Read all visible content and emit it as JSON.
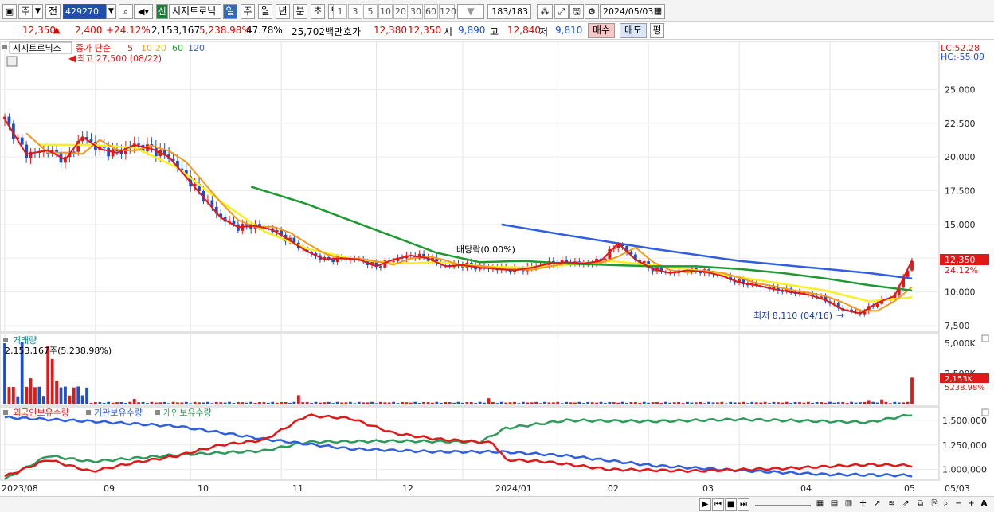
{
  "toolbar": {
    "market": "주",
    "prev_label": "전",
    "code": "429270",
    "sin_label": "신",
    "stock_name": "시지트로닉",
    "period_tabs": [
      "일",
      "주",
      "월",
      "년",
      "분",
      "초",
      "틱"
    ],
    "active_tab": "일",
    "minute_options": [
      "1",
      "3",
      "5",
      "10",
      "20",
      "30",
      "60",
      "120"
    ],
    "count": "183",
    "count_total": "/183",
    "date": "2024/05/03"
  },
  "quote": {
    "price": "12,350",
    "change_arrow": "▲",
    "change": "2,400",
    "change_pct": "+24.12%",
    "volume": "2,153,167",
    "volume_pct": "5,238.98%",
    "turnover_pct": "47.78%",
    "amount": "25,702백만",
    "bid_label": "호가",
    "ask_price": "12,380",
    "bid_price": "12,350",
    "open_label": "시",
    "open": "9,890",
    "high_label": "고",
    "high": "12,840",
    "low_label": "저",
    "low": "9,810",
    "buy_label": "매수",
    "sell_label": "매도",
    "avg_label": "평"
  },
  "price_panel": {
    "stock_label": "시지트로닉스",
    "ma_title": "종가 단순",
    "ma_periods": [
      "5",
      "10",
      "20",
      "60",
      "120"
    ],
    "high_note": "최고 27,500 (08/22)",
    "low_note": "최저 8,110 (04/16)",
    "dividend_note": "배당락(0.00%)",
    "lc": "LC:52.28",
    "hc": "HC:-55.09",
    "price_tag": "12,350",
    "pct_tag": "24.12%",
    "y_ticks": [
      "25,000",
      "22,500",
      "20,000",
      "17,500",
      "15,000",
      "12,500",
      "10,000",
      "7,500"
    ]
  },
  "volume_panel": {
    "title": "거래량",
    "value_label": "2,153,167주(5,238.98%)",
    "y_ticks": [
      "5,000K",
      "2,500K"
    ],
    "tag": "2,153K",
    "tag_pct": "5238.98%"
  },
  "holder_panel": {
    "series_labels": [
      "외국인보유수량",
      "기관보유수량",
      "개인보유수량"
    ],
    "y_ticks": [
      "1,500,000",
      "1,250,000",
      "1,000,000"
    ]
  },
  "x_axis": [
    "2023/08",
    "09",
    "10",
    "11",
    "12",
    "2024/01",
    "02",
    "03",
    "04",
    "05",
    "05/03"
  ],
  "colors": {
    "ma5": "#e01818",
    "ma10": "#f39a1e",
    "ma20": "#f8f020",
    "ma60": "#1e9a32",
    "ma120": "#2f5fe0",
    "up": "#e01818",
    "down": "#1d4fc8",
    "foreign": "#e01818",
    "institution": "#2f5fe0",
    "individual": "#2e9a5a"
  },
  "chart_data": {
    "type": "candlestick",
    "dates_range": [
      "2023/08",
      "2024/05/03"
    ],
    "candles_count": 183,
    "price_ylim": [
      7500,
      27500
    ],
    "close_path": [
      [
        0,
        22800
      ],
      [
        5,
        20200
      ],
      [
        10,
        20500
      ],
      [
        14,
        19800
      ],
      [
        18,
        21500
      ],
      [
        22,
        20600
      ],
      [
        26,
        20300
      ],
      [
        30,
        20900
      ],
      [
        34,
        20600
      ],
      [
        38,
        20000
      ],
      [
        42,
        18500
      ],
      [
        46,
        17000
      ],
      [
        50,
        15500
      ],
      [
        54,
        14800
      ],
      [
        58,
        14900
      ],
      [
        62,
        14600
      ],
      [
        66,
        13800
      ],
      [
        70,
        13000
      ],
      [
        74,
        12400
      ],
      [
        78,
        12500
      ],
      [
        82,
        12400
      ],
      [
        86,
        11900
      ],
      [
        90,
        12400
      ],
      [
        94,
        12700
      ],
      [
        98,
        12500
      ],
      [
        102,
        11900
      ],
      [
        106,
        12000
      ],
      [
        110,
        11800
      ],
      [
        114,
        11700
      ],
      [
        118,
        11600
      ],
      [
        122,
        11800
      ],
      [
        126,
        12100
      ],
      [
        130,
        12200
      ],
      [
        134,
        12100
      ],
      [
        138,
        12300
      ],
      [
        142,
        13600
      ],
      [
        146,
        12400
      ],
      [
        150,
        11700
      ],
      [
        154,
        11400
      ],
      [
        158,
        11600
      ],
      [
        162,
        11500
      ],
      [
        166,
        11200
      ],
      [
        170,
        10700
      ],
      [
        174,
        10500
      ],
      [
        178,
        10200
      ],
      [
        182,
        10000
      ],
      [
        186,
        9800
      ],
      [
        190,
        9400
      ],
      [
        194,
        8700
      ],
      [
        198,
        8400
      ],
      [
        202,
        9200
      ],
      [
        206,
        9700
      ],
      [
        210,
        12350
      ]
    ],
    "ma20_path": [
      [
        8,
        20900
      ],
      [
        20,
        20900
      ],
      [
        30,
        20700
      ],
      [
        40,
        19200
      ],
      [
        50,
        16700
      ],
      [
        60,
        14500
      ],
      [
        70,
        13200
      ],
      [
        80,
        12500
      ],
      [
        90,
        12100
      ],
      [
        100,
        12200
      ],
      [
        110,
        11900
      ],
      [
        120,
        11800
      ],
      [
        130,
        12000
      ],
      [
        140,
        12300
      ],
      [
        150,
        12000
      ],
      [
        160,
        11600
      ],
      [
        170,
        11100
      ],
      [
        180,
        10600
      ],
      [
        190,
        10100
      ],
      [
        200,
        9300
      ],
      [
        210,
        9600
      ]
    ],
    "ma60_path": [
      [
        57,
        17800
      ],
      [
        70,
        16500
      ],
      [
        80,
        15300
      ],
      [
        90,
        14100
      ],
      [
        100,
        12900
      ],
      [
        110,
        12200
      ],
      [
        120,
        12300
      ],
      [
        130,
        12100
      ],
      [
        140,
        12000
      ],
      [
        150,
        11900
      ],
      [
        160,
        11900
      ],
      [
        170,
        11700
      ],
      [
        180,
        11400
      ],
      [
        190,
        11000
      ],
      [
        200,
        10500
      ],
      [
        210,
        10100
      ]
    ],
    "ma120_path": [
      [
        115,
        15000
      ],
      [
        130,
        14200
      ],
      [
        150,
        13200
      ],
      [
        170,
        12300
      ],
      [
        190,
        11700
      ],
      [
        200,
        11400
      ],
      [
        210,
        11000
      ]
    ],
    "volume_spikes_k": [
      [
        0,
        5000
      ],
      [
        4,
        5100
      ],
      [
        6,
        2100
      ],
      [
        10,
        4800
      ],
      [
        11,
        3700
      ],
      [
        12,
        1900
      ],
      [
        30,
        400
      ],
      [
        68,
        700
      ],
      [
        112,
        450
      ],
      [
        200,
        300
      ],
      [
        203,
        350
      ],
      [
        210,
        2153
      ]
    ],
    "holder_lines": {
      "foreign": [
        [
          0,
          930000
        ],
        [
          10,
          1100000
        ],
        [
          20,
          980000
        ],
        [
          30,
          1070000
        ],
        [
          40,
          1140000
        ],
        [
          50,
          1250000
        ],
        [
          60,
          1300000
        ],
        [
          70,
          1550000
        ],
        [
          80,
          1520000
        ],
        [
          90,
          1370000
        ],
        [
          100,
          1310000
        ],
        [
          110,
          1280000
        ],
        [
          113,
          1270000
        ],
        [
          116,
          1100000
        ],
        [
          125,
          1080000
        ],
        [
          140,
          1000000
        ],
        [
          160,
          985000
        ],
        [
          180,
          1010000
        ],
        [
          200,
          1050000
        ],
        [
          210,
          1040000
        ]
      ],
      "institution": [
        [
          0,
          1530000
        ],
        [
          20,
          1490000
        ],
        [
          40,
          1440000
        ],
        [
          60,
          1310000
        ],
        [
          80,
          1210000
        ],
        [
          100,
          1180000
        ],
        [
          115,
          1180000
        ],
        [
          130,
          1140000
        ],
        [
          150,
          1040000
        ],
        [
          170,
          990000
        ],
        [
          190,
          950000
        ],
        [
          210,
          940000
        ]
      ],
      "individual": [
        [
          0,
          900000
        ],
        [
          10,
          1140000
        ],
        [
          20,
          1080000
        ],
        [
          40,
          1150000
        ],
        [
          60,
          1190000
        ],
        [
          70,
          1280000
        ],
        [
          90,
          1290000
        ],
        [
          110,
          1280000
        ],
        [
          116,
          1420000
        ],
        [
          130,
          1500000
        ],
        [
          150,
          1490000
        ],
        [
          170,
          1510000
        ],
        [
          190,
          1490000
        ],
        [
          200,
          1480000
        ],
        [
          210,
          1560000
        ]
      ]
    }
  }
}
